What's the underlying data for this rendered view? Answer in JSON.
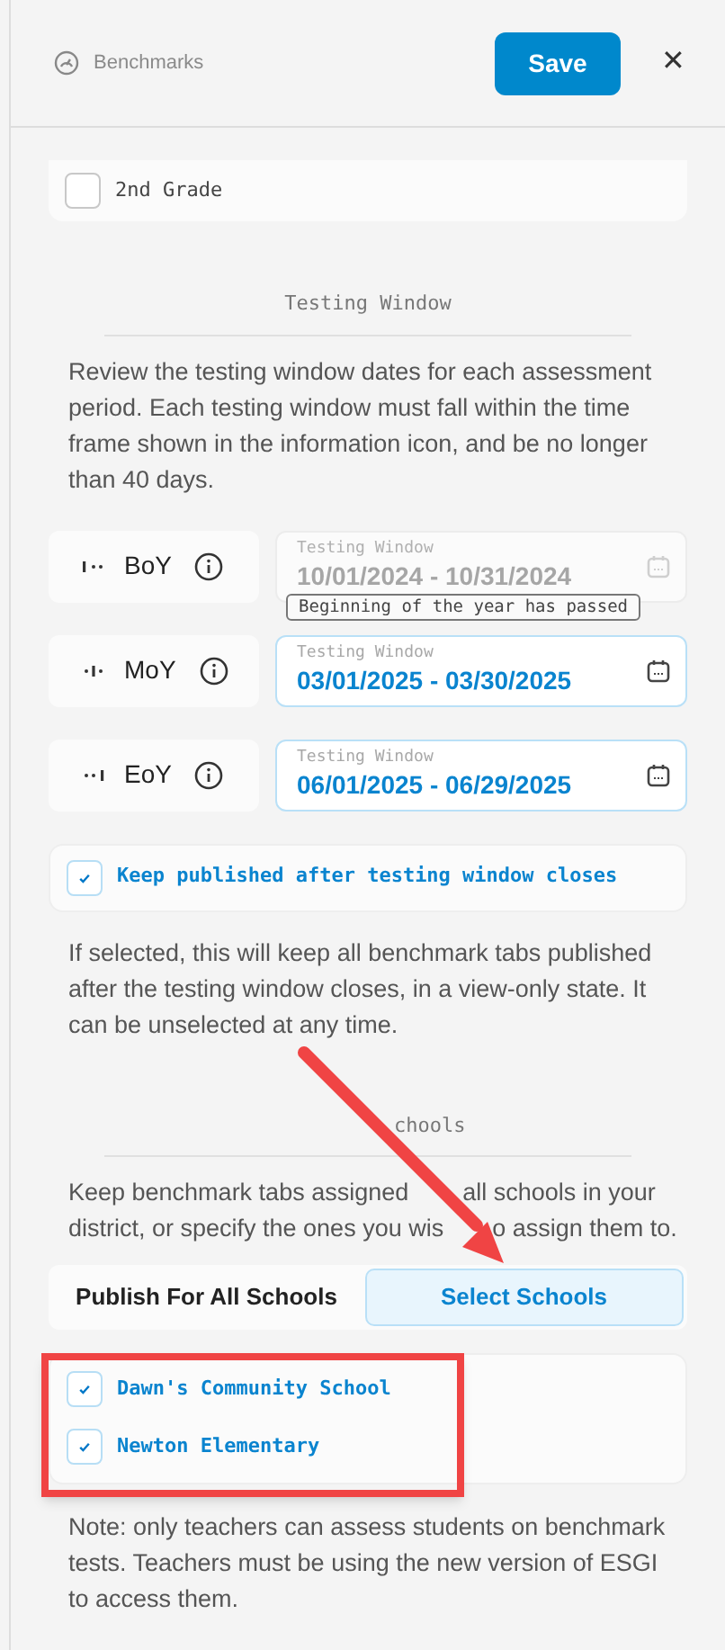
{
  "header": {
    "title": "Benchmarks",
    "save": "Save",
    "close": "✕"
  },
  "grades": [
    {
      "label": "2nd Grade",
      "checked": false
    }
  ],
  "testing_window": {
    "heading": "Testing Window",
    "description": "Review the testing window dates for each assessment period. Each testing window must fall within the time frame shown in the information icon, and be no longer than 40 days.",
    "periods": [
      {
        "label": "BoY",
        "kind": "start",
        "field_label": "Testing Window",
        "value": "10/01/2024 - 10/31/2024",
        "disabled": true,
        "tooltip": "Beginning of the year has passed"
      },
      {
        "label": "MoY",
        "kind": "middle",
        "field_label": "Testing Window",
        "value": "03/01/2025 - 03/30/2025",
        "disabled": false
      },
      {
        "label": "EoY",
        "kind": "end",
        "field_label": "Testing Window",
        "value": "06/01/2025 - 06/29/2025",
        "disabled": false
      }
    ]
  },
  "keep_published": {
    "label": "Keep published after testing window closes",
    "checked": true,
    "description": "If selected, this will keep all benchmark tabs published after the testing window closes, in a view-only state. It can be unselected at any time."
  },
  "schools": {
    "heading": "chools",
    "description_lines": [
      [
        "Keep benchmark tabs assigned",
        "all schools in your"
      ],
      [
        "district, or specify the ones you wis",
        "o assign them to."
      ]
    ],
    "tabs": [
      {
        "label": "Publish For All Schools",
        "selected": false
      },
      {
        "label": "Select Schools",
        "selected": true
      }
    ],
    "items": [
      {
        "label": "Dawn's Community School",
        "checked": true
      },
      {
        "label": "Newton Elementary",
        "checked": true
      }
    ],
    "note": "Note: only teachers can assess students on benchmark tests. Teachers must be using the new version of ESGI to access them."
  },
  "annotations": {
    "arrow": true,
    "box": true
  }
}
